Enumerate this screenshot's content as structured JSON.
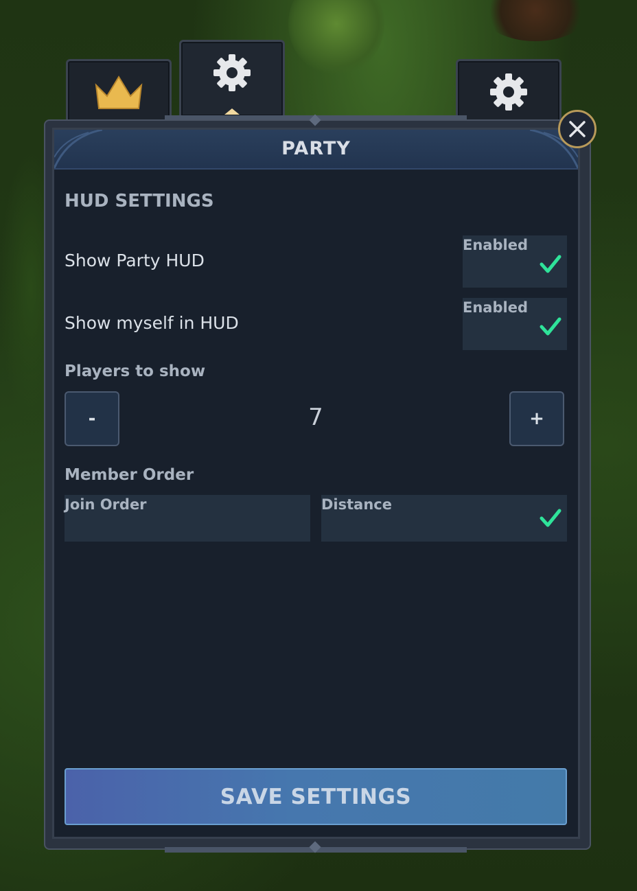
{
  "tabs": [
    {
      "icon": "crown-icon",
      "active": false
    },
    {
      "icon": "gear-icon",
      "active": true
    },
    {
      "icon": "gear-icon",
      "active": false
    }
  ],
  "header": {
    "title": "PARTY"
  },
  "hud": {
    "section_title": "HUD SETTINGS",
    "show_party_hud": {
      "label": "Show Party HUD",
      "state": "Enabled",
      "checked": true
    },
    "show_myself": {
      "label": "Show myself in HUD",
      "state": "Enabled",
      "checked": true
    },
    "players_to_show": {
      "label": "Players to show",
      "value": "7",
      "minus": "-",
      "plus": "+"
    },
    "member_order": {
      "label": "Member Order",
      "options": [
        {
          "label": "Join Order",
          "selected": false
        },
        {
          "label": "Distance",
          "selected": true
        }
      ]
    }
  },
  "save_button": {
    "label": "SAVE SETTINGS"
  },
  "colors": {
    "accent_check": "#2fe39a",
    "gold": "#e9b94f",
    "save": "#4677ae"
  }
}
